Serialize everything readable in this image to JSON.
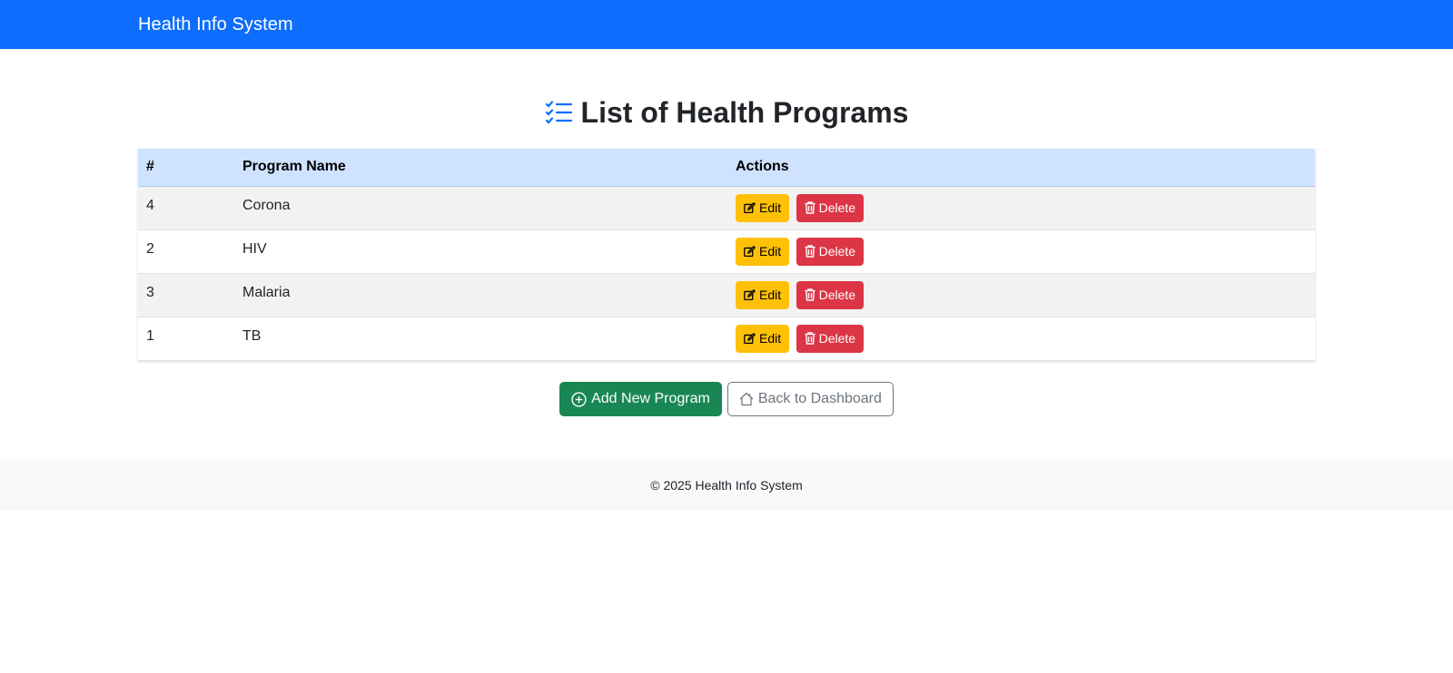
{
  "navbar": {
    "brand": "Health Info System",
    "color": "#0d6efd"
  },
  "page": {
    "title": "List of Health Programs",
    "title_icon": "list-check-icon"
  },
  "table": {
    "headers": [
      "#",
      "Program Name",
      "Actions"
    ],
    "rows": [
      {
        "id": "4",
        "name": "Corona"
      },
      {
        "id": "2",
        "name": "HIV"
      },
      {
        "id": "3",
        "name": "Malaria"
      },
      {
        "id": "1",
        "name": "TB"
      }
    ],
    "edit_label": "Edit",
    "delete_label": "Delete",
    "edit_color": "#ffc107",
    "delete_color": "#dc3545",
    "header_color": "#cfe2ff"
  },
  "actions": {
    "add_label": "Add New Program",
    "add_icon": "plus-circle-icon",
    "back_label": "Back to Dashboard",
    "back_icon": "house-icon"
  },
  "footer": {
    "text": "© 2025 Health Info System"
  }
}
